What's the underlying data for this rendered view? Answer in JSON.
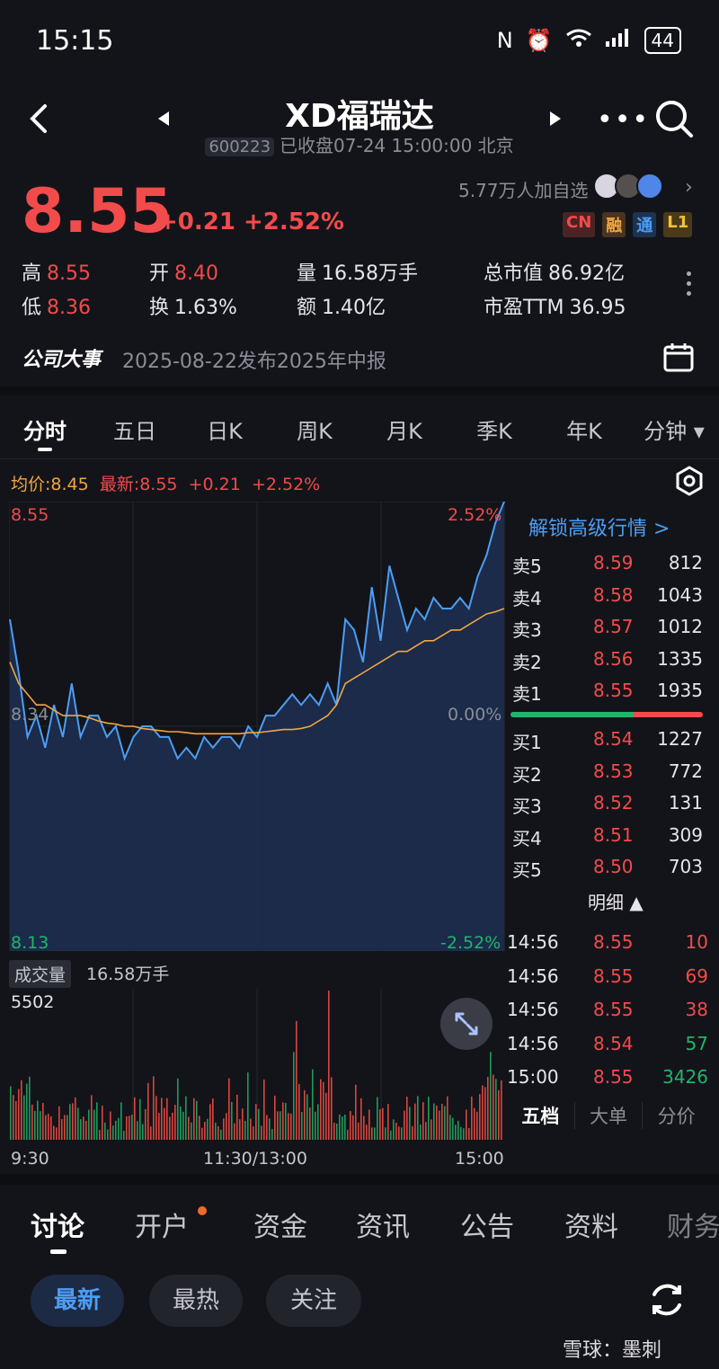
{
  "status_bar": {
    "time": "15:15",
    "battery": "44"
  },
  "header": {
    "name": "XD福瑞达",
    "code": "600223",
    "market_status": "已收盘07-24 15:00:00 北京"
  },
  "quote": {
    "price": "8.55",
    "change": "+0.21",
    "change_pct": "+2.52%",
    "followers": "5.77万人加自选",
    "badges": [
      "CN",
      "融",
      "通",
      "L1"
    ]
  },
  "stats": {
    "high_label": "高",
    "high": "8.55",
    "open_label": "开",
    "open": "8.40",
    "volume_label": "量",
    "volume": "16.58万手",
    "mcap_label": "总市值",
    "mcap": "86.92亿",
    "low_label": "低",
    "low": "8.36",
    "turnover_label": "换",
    "turnover": "1.63%",
    "amount_label": "额",
    "amount": "1.40亿",
    "pe_label": "市盈TTM",
    "pe": "36.95"
  },
  "events": {
    "title": "公司大事",
    "text": "2025-08-22发布2025年中报"
  },
  "chart_tabs": [
    "分时",
    "五日",
    "日K",
    "周K",
    "月K",
    "季K",
    "年K",
    "分钟 ▾"
  ],
  "chart_legend": {
    "avg_label": "均价:8.45",
    "latest_label": "最新:8.55",
    "change": "+0.21",
    "change_pct": "+2.52%"
  },
  "chart_axis": {
    "y_top": "8.55",
    "y_mid": "8.34",
    "y_bottom": "8.13",
    "pct_top": "2.52%",
    "pct_mid": "0.00%",
    "pct_bottom": "-2.52%"
  },
  "colors": {
    "up": "#f24b4b",
    "down": "#22b46c",
    "price_line": "#4c9df5",
    "avg_line": "#f3a640"
  },
  "chart_data": {
    "type": "line",
    "x_ticks": [
      "9:30",
      "11:30/13:00",
      "15:00"
    ],
    "ylim": [
      8.13,
      8.55
    ],
    "series": [
      {
        "name": "最新",
        "values": [
          8.44,
          8.39,
          8.33,
          8.35,
          8.32,
          8.36,
          8.33,
          8.38,
          8.33,
          8.35,
          8.35,
          8.33,
          8.34,
          8.31,
          8.33,
          8.34,
          8.34,
          8.33,
          8.33,
          8.31,
          8.32,
          8.31,
          8.33,
          8.32,
          8.33,
          8.33,
          8.32,
          8.34,
          8.33,
          8.35,
          8.35,
          8.36,
          8.37,
          8.36,
          8.37,
          8.36,
          8.38,
          8.36,
          8.44,
          8.43,
          8.4,
          8.47,
          8.42,
          8.49,
          8.46,
          8.43,
          8.45,
          8.44,
          8.46,
          8.45,
          8.45,
          8.46,
          8.45,
          8.48,
          8.5,
          8.53,
          8.55
        ]
      },
      {
        "name": "均价",
        "values": [
          8.4,
          8.38,
          8.37,
          8.36,
          8.36,
          8.355,
          8.35,
          8.35,
          8.35,
          8.348,
          8.345,
          8.343,
          8.342,
          8.34,
          8.34,
          8.338,
          8.337,
          8.336,
          8.335,
          8.335,
          8.334,
          8.333,
          8.333,
          8.333,
          8.333,
          8.333,
          8.333,
          8.334,
          8.334,
          8.335,
          8.336,
          8.337,
          8.337,
          8.338,
          8.34,
          8.345,
          8.35,
          8.36,
          8.38,
          8.385,
          8.39,
          8.395,
          8.4,
          8.405,
          8.41,
          8.41,
          8.415,
          8.42,
          8.42,
          8.425,
          8.43,
          8.43,
          8.435,
          8.44,
          8.445,
          8.447,
          8.45
        ]
      }
    ]
  },
  "order_book": {
    "unlock": "解锁高级行情 >",
    "asks": [
      {
        "label": "卖5",
        "price": "8.59",
        "vol": "812"
      },
      {
        "label": "卖4",
        "price": "8.58",
        "vol": "1043"
      },
      {
        "label": "卖3",
        "price": "8.57",
        "vol": "1012"
      },
      {
        "label": "卖2",
        "price": "8.56",
        "vol": "1335"
      },
      {
        "label": "卖1",
        "price": "8.55",
        "vol": "1935"
      }
    ],
    "bids": [
      {
        "label": "买1",
        "price": "8.54",
        "vol": "1227"
      },
      {
        "label": "买2",
        "price": "8.53",
        "vol": "772"
      },
      {
        "label": "买3",
        "price": "8.52",
        "vol": "131"
      },
      {
        "label": "买4",
        "price": "8.51",
        "vol": "309"
      },
      {
        "label": "买5",
        "price": "8.50",
        "vol": "703"
      }
    ],
    "buy_ratio": 0.64
  },
  "details": {
    "title": "明细 ▲",
    "rows": [
      {
        "time": "14:56",
        "price": "8.55",
        "vol": "10",
        "dir": "up"
      },
      {
        "time": "14:56",
        "price": "8.55",
        "vol": "69",
        "dir": "up"
      },
      {
        "time": "14:56",
        "price": "8.55",
        "vol": "38",
        "dir": "up"
      },
      {
        "time": "14:56",
        "price": "8.54",
        "vol": "57",
        "dir": "down"
      },
      {
        "time": "15:00",
        "price": "8.55",
        "vol": "3426",
        "dir": "down"
      }
    ],
    "tabs": [
      "五档",
      "大单",
      "分价"
    ]
  },
  "volume": {
    "label": "成交量",
    "value": "16.58万手",
    "max_label": "5502"
  },
  "bottom_tabs": [
    "讨论",
    "开户",
    "资金",
    "资讯",
    "公告",
    "资料",
    "财务"
  ],
  "filters": [
    "最新",
    "最热",
    "关注"
  ],
  "watermark": "雪球：墨刺"
}
